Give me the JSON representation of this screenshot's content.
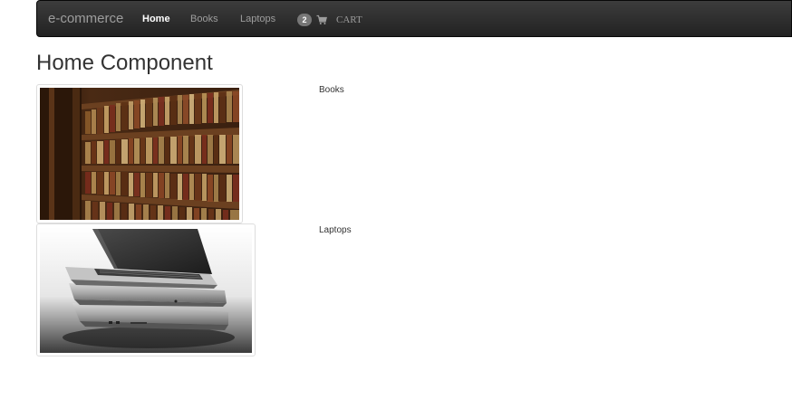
{
  "navbar": {
    "brand": "e-commerce",
    "links": [
      {
        "label": "Home",
        "active": true
      },
      {
        "label": "Books",
        "active": false
      },
      {
        "label": "Laptops",
        "active": false
      }
    ],
    "cart": {
      "count": "2",
      "icon": "shopping-cart-icon",
      "label": "CART"
    }
  },
  "page": {
    "title": "Home Component"
  },
  "categories": [
    {
      "label": "Books",
      "image": "bookshelf-photo"
    },
    {
      "label": "Laptops",
      "image": "stacked-laptops-photo"
    }
  ]
}
